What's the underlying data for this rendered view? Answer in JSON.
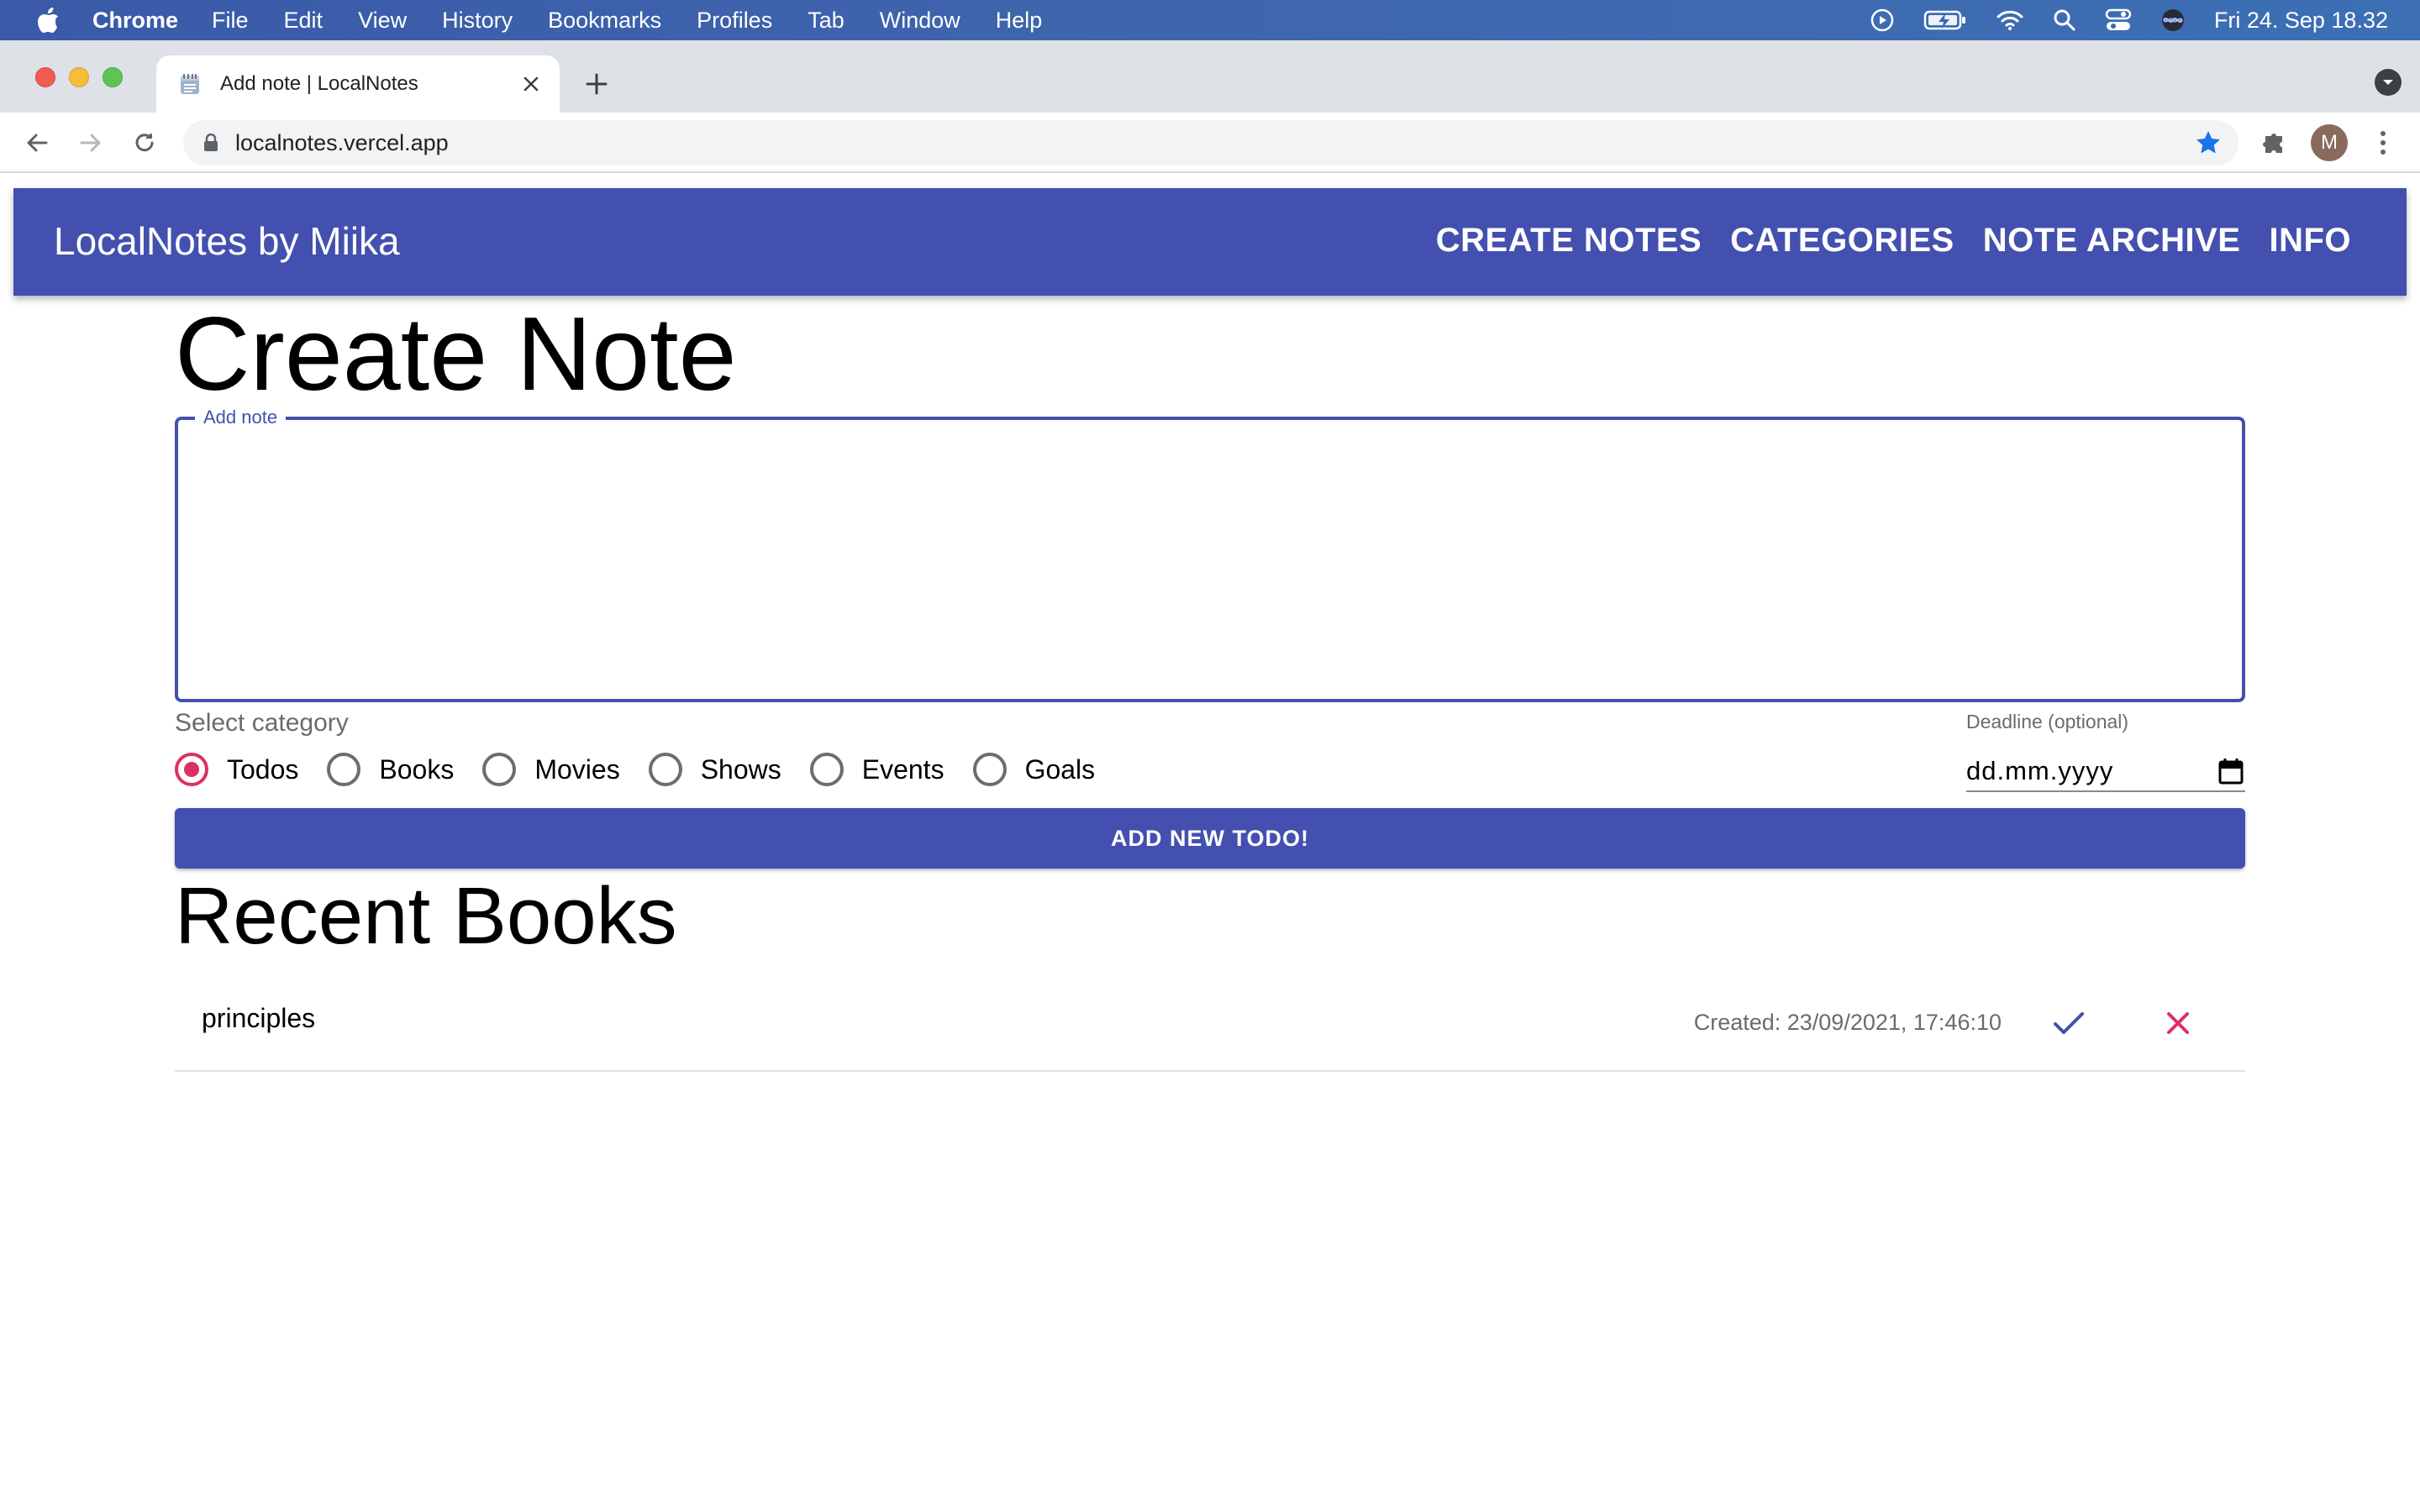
{
  "menubar": {
    "app_name": "Chrome",
    "items": [
      "File",
      "Edit",
      "View",
      "History",
      "Bookmarks",
      "Profiles",
      "Tab",
      "Window",
      "Help"
    ],
    "clock": "Fri 24. Sep  18.32"
  },
  "browser": {
    "tab_title": "Add note | LocalNotes",
    "url": "localnotes.vercel.app",
    "profile_initial": "M"
  },
  "app": {
    "brand": "LocalNotes by Miika",
    "nav": [
      "CREATE NOTES",
      "CATEGORIES",
      "NOTE ARCHIVE",
      "INFO"
    ]
  },
  "create_note": {
    "title": "Create Note",
    "note_field_label": "Add note",
    "note_value": "",
    "category_label": "Select category",
    "categories": [
      "Todos",
      "Books",
      "Movies",
      "Shows",
      "Events",
      "Goals"
    ],
    "selected_category": "Todos",
    "deadline_label": "Deadline (optional)",
    "deadline_value": "dd.mm.yyyy",
    "submit_label": "ADD NEW TODO!"
  },
  "recent": {
    "title": "Recent Books",
    "items": [
      {
        "text": "principles",
        "created": "Created: 23/09/2021, 17:46:10"
      }
    ]
  },
  "colors": {
    "primary": "#4350af",
    "accent": "#dc3160",
    "menubar": "#3f66ad"
  }
}
